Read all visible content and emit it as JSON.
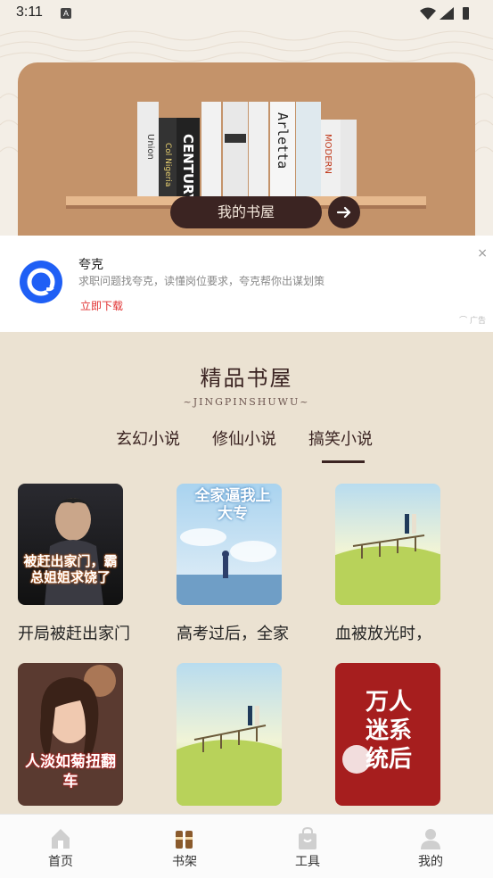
{
  "status": {
    "time": "3:11",
    "notif_badge": "A"
  },
  "banner": {
    "my_shelf_label": "我的书屋"
  },
  "ad": {
    "title": "夸克",
    "description": "求职问题找夸克，读懂岗位要求，夸克帮你出谋划策",
    "cta": "立即下载",
    "close": "×",
    "ad_label": "⌒ 广告"
  },
  "section": {
    "title": "精品书屋",
    "subtitle": "~JINGPINSHUWU~",
    "tabs": [
      {
        "label": "玄幻小说",
        "active": false
      },
      {
        "label": "修仙小说",
        "active": false
      },
      {
        "label": "搞笑小说",
        "active": true
      }
    ]
  },
  "books": [
    {
      "title": "开局被赶出家门",
      "cover_text": "被赶出家门，霸总姐姐求饶了"
    },
    {
      "title": "高考过后，全家",
      "cover_text": "全家逼我上大专"
    },
    {
      "title": "血被放光时，",
      "cover_text": ""
    },
    {
      "title": "",
      "cover_text": "人淡如菊扭翻车"
    },
    {
      "title": "",
      "cover_text": ""
    },
    {
      "title": "",
      "cover_text": "万人迷系统后"
    }
  ],
  "nav": {
    "items": [
      {
        "label": "首页",
        "icon": "home-icon"
      },
      {
        "label": "书架",
        "icon": "bookshelf-icon"
      },
      {
        "label": "工具",
        "icon": "tools-bag-icon"
      },
      {
        "label": "我的",
        "icon": "profile-icon"
      }
    ]
  },
  "colors": {
    "accent": "#3b2422",
    "card": "#c4936a",
    "page_bg": "#ebe2d2",
    "cta_red": "#e03030"
  }
}
